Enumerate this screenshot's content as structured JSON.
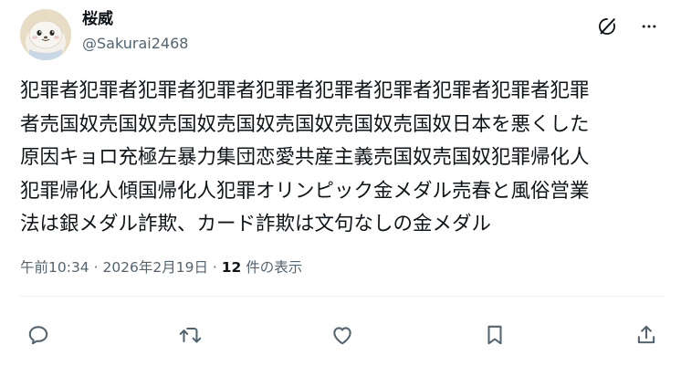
{
  "author": {
    "display_name": "桜威",
    "handle": "@Sakurai2468"
  },
  "tweet": {
    "text": "犯罪者犯罪者犯罪者犯罪者犯罪者犯罪者犯罪者犯罪者犯罪者犯罪\n者売国奴売国奴売国奴売国奴売国奴売国奴売国奴日本を悪くした\n原因キョロ充極左暴力集団恋愛共産主義売国奴売国奴犯罪帰化人\n犯罪帰化人傾国帰化人犯罪オリンピック金メダル売春と風俗営業\n法は銀メダル詐欺、カード詐欺は文句なしの金メダル"
  },
  "meta": {
    "time": "午前10:34",
    "sep1": " · ",
    "date": "2026年2月19日",
    "sep2": " · ",
    "views_count": "12",
    "views_label": " 件の表示"
  },
  "icons": {
    "header": [
      "grok-icon",
      "more-icon"
    ],
    "actions": [
      "reply-icon",
      "retweet-icon",
      "like-icon",
      "bookmark-icon",
      "share-icon"
    ]
  },
  "colors": {
    "text": "#0f1419",
    "secondary": "#536471",
    "divider": "#eff3f4"
  }
}
